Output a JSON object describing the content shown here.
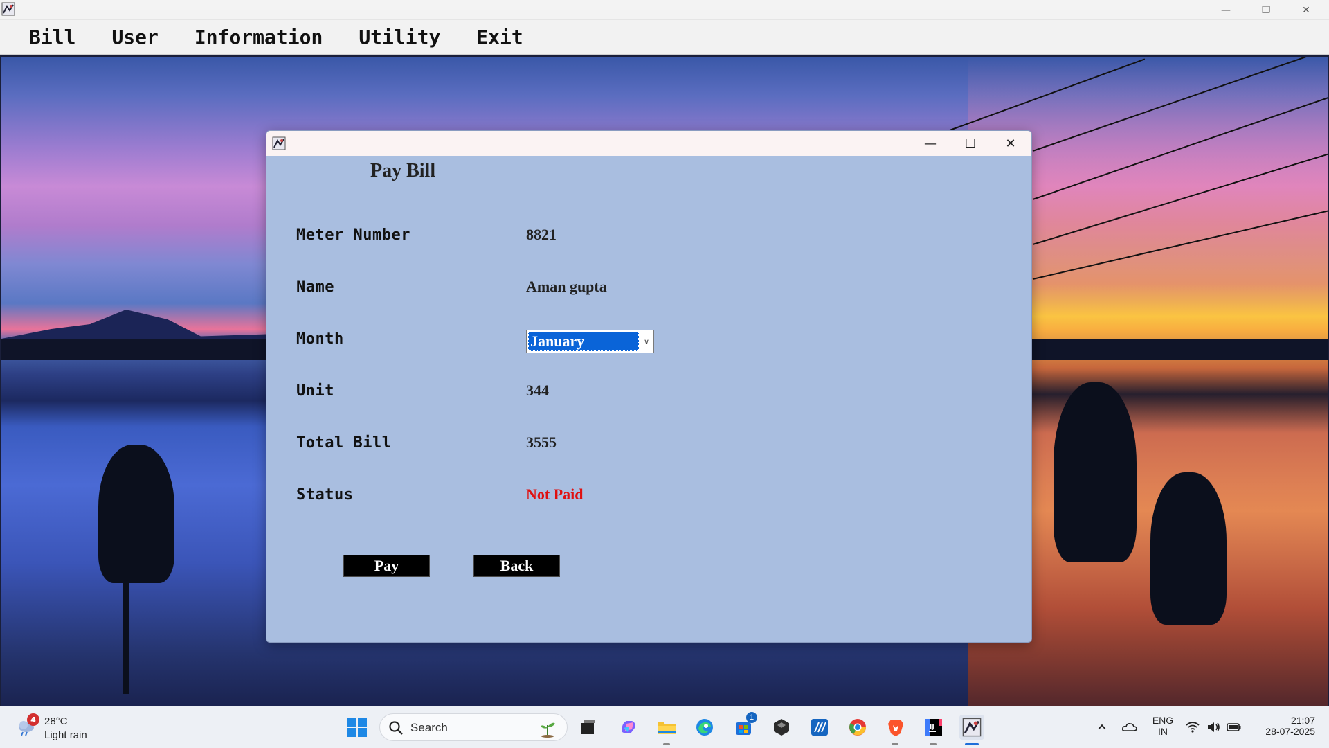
{
  "menu": {
    "items": [
      "Bill",
      "User",
      "Information",
      "Utility",
      "Exit"
    ]
  },
  "dialog": {
    "heading": "Pay Bill",
    "fields": {
      "meter_label": "Meter Number",
      "meter_value": "8821",
      "name_label": "Name",
      "name_value": "Aman gupta",
      "month_label": "Month",
      "month_value": "January",
      "unit_label": "Unit",
      "unit_value": "344",
      "total_label": "Total Bill",
      "total_value": "3555",
      "status_label": "Status",
      "status_value": "Not Paid"
    },
    "buttons": {
      "pay": "Pay",
      "back": "Back"
    }
  },
  "taskbar": {
    "weather": {
      "badge": "4",
      "temp": "28°C",
      "condition": "Light rain"
    },
    "search_placeholder": "Search",
    "store_badge": "1",
    "lang_1": "ENG",
    "lang_2": "IN",
    "time": "21:07",
    "date": "28-07-2025"
  },
  "colors": {
    "dialog_bg": "#a9bee0",
    "status_red": "#e01010",
    "select_highlight": "#0a64d8"
  }
}
